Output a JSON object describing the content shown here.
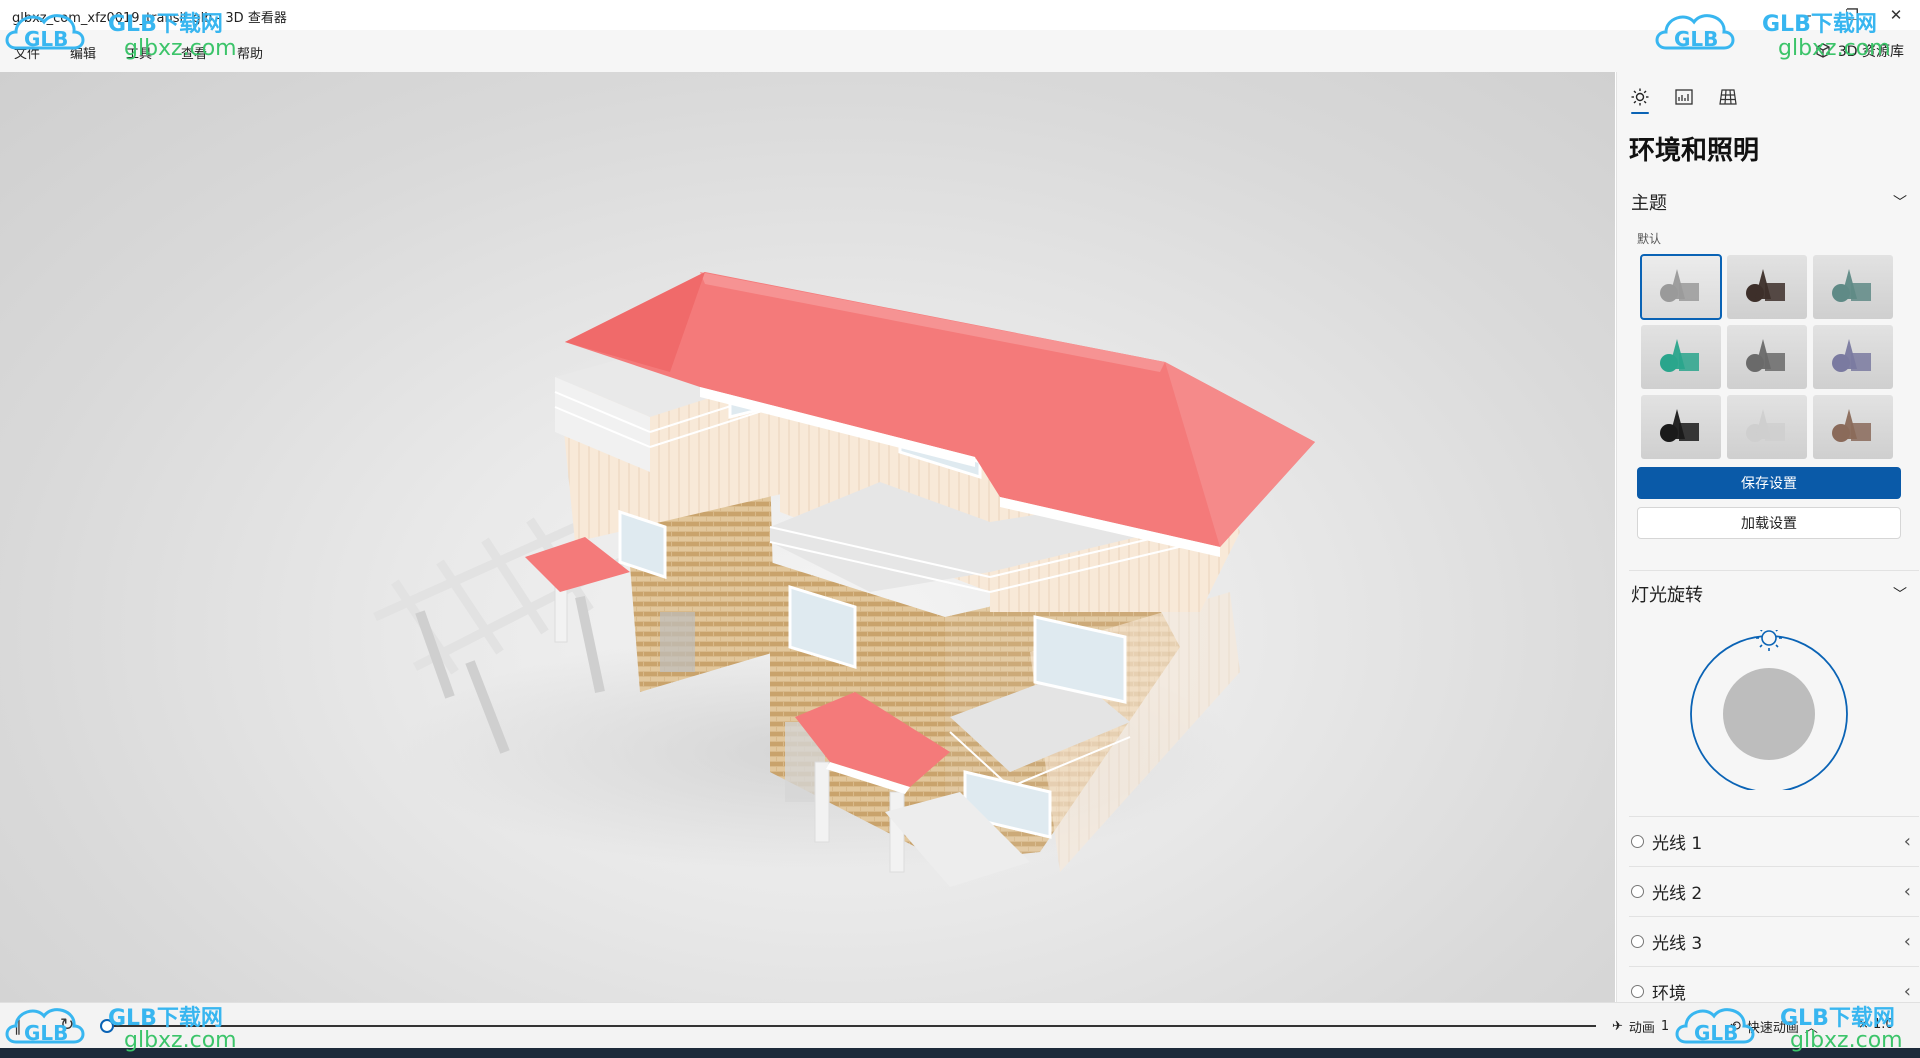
{
  "window": {
    "title": "glbxz_com_xfz0019_transit.glb - 3D 查看器"
  },
  "menu": {
    "items": [
      "文件",
      "编辑",
      "工具",
      "查看",
      "帮助"
    ],
    "resource_library": "3D 资源库"
  },
  "panel": {
    "tabs": [
      "sun-icon",
      "stats-icon",
      "grid-icon"
    ],
    "title": "环境和照明",
    "theme": {
      "header": "主题",
      "label": "默认",
      "swatch_colors": [
        "#9a9a9a",
        "#3d2f2a",
        "#5f8a86",
        "#2aa58c",
        "#6a6a6a",
        "#7a7aa0",
        "#1a1a1a",
        "#cfcfcf",
        "#8a6a5a"
      ],
      "save_button": "保存设置",
      "load_button": "加载设置"
    },
    "light_rotation": {
      "header": "灯光旋转"
    },
    "lights": [
      "光线 1",
      "光线 2",
      "光线 3",
      "环境"
    ]
  },
  "bottom": {
    "animation_label": "动画",
    "animation_index": "1",
    "quick_animation": "快速动画",
    "speed": "× 1.0"
  },
  "watermark": {
    "text": "GLB下载网",
    "url": "glbxz.com",
    "logo": "GLB"
  },
  "colors": {
    "accent": "#0a63b5",
    "roof": "#f47a7a"
  }
}
